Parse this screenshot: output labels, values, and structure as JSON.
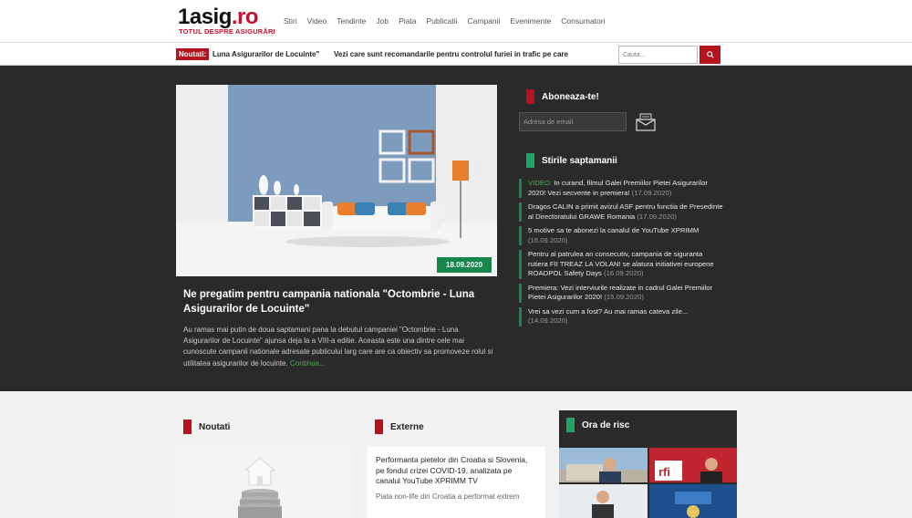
{
  "header": {
    "logo_main": "1asig",
    "logo_dot": ".ro",
    "logo_tagline": "TOTUL DESPRE ASIGURĂRI",
    "nav": [
      "Stiri",
      "Video",
      "Tendinte",
      "Job",
      "Piata",
      "Publicatii",
      "Campanii",
      "Evenimente",
      "Consumatori"
    ]
  },
  "ticker": {
    "label": "Noutati:",
    "item1": "Luna Asigurarilor de Locuinte\"",
    "item2": "Vezi care sunt recomandarile pentru controlul furiei in trafic pe care",
    "search_placeholder": "Cauta..."
  },
  "hero": {
    "date": "18.09.2020",
    "title": "Ne pregatim pentru campania nationala \"Octombrie - Luna Asigurarilor de Locuinte\"",
    "text": "Au ramas mai putin de doua saptamani pana la debutul campaniei \"Octombrie - Luna Asigurarilor de Locuinte\" ajunsa deja la a VIII-a editie. Aceasta este una dintre cele mai cunoscute campanii nationale adresate publicului larg care are ca obiectiv sa promoveze rolul si utilitatea asigurarilor de locuinte.",
    "more": "Continua..."
  },
  "subscribe": {
    "title": "Aboneaza-te!",
    "email_placeholder": "Adresa de email"
  },
  "weekly": {
    "title": "Stirile saptamanii",
    "items": [
      {
        "tag": "VIDEO:",
        "text": " In curand, filmul Galei Premiilor Pietei Asigurarilor 2020! Vezi secvente in premiera!",
        "date": " (17.09.2020)"
      },
      {
        "tag": "",
        "text": "Dragos CALIN a primit avizul ASF pentru functia de Presedinte al Directoratului GRAWE Romania",
        "date": " (17.09.2020)"
      },
      {
        "tag": "",
        "text": "5 motive sa te abonezi la canalul de YouTube XPRIMM",
        "date": " (16.09.2020)"
      },
      {
        "tag": "",
        "text": "Pentru al patrulea an consecutiv, campania de siguranta rutiera FII TREAZ LA VOLAN! se alatura initiativei europene ROADPOL Safety Days",
        "date": " (16.09.2020)"
      },
      {
        "tag": "",
        "text": "Premiera: Vezi interviurile realizate in cadrul Galei Premiilor Pietei Asigurarilor 2020!",
        "date": " (15.09.2020)"
      },
      {
        "tag": "",
        "text": "Vrei sa vezi cum a fost? Au mai ramas cateva zile...",
        "date": " (14.09.2020)"
      }
    ]
  },
  "lower": {
    "noutati_title": "Noutati",
    "externe_title": "Externe",
    "externe_card_title": "Performanta pietelor din Croatia si Slovenia, pe fondul crizei COVID-19, analizata pe canalul YouTube XPRIMM TV",
    "externe_card_snippet": "Piata non-life din Croatia a performat extrem",
    "risc_title": "Ora de risc"
  },
  "colors": {
    "brand_red": "#b5131d",
    "accent_green": "#17864a",
    "dark_bg": "#2a2a2a"
  }
}
